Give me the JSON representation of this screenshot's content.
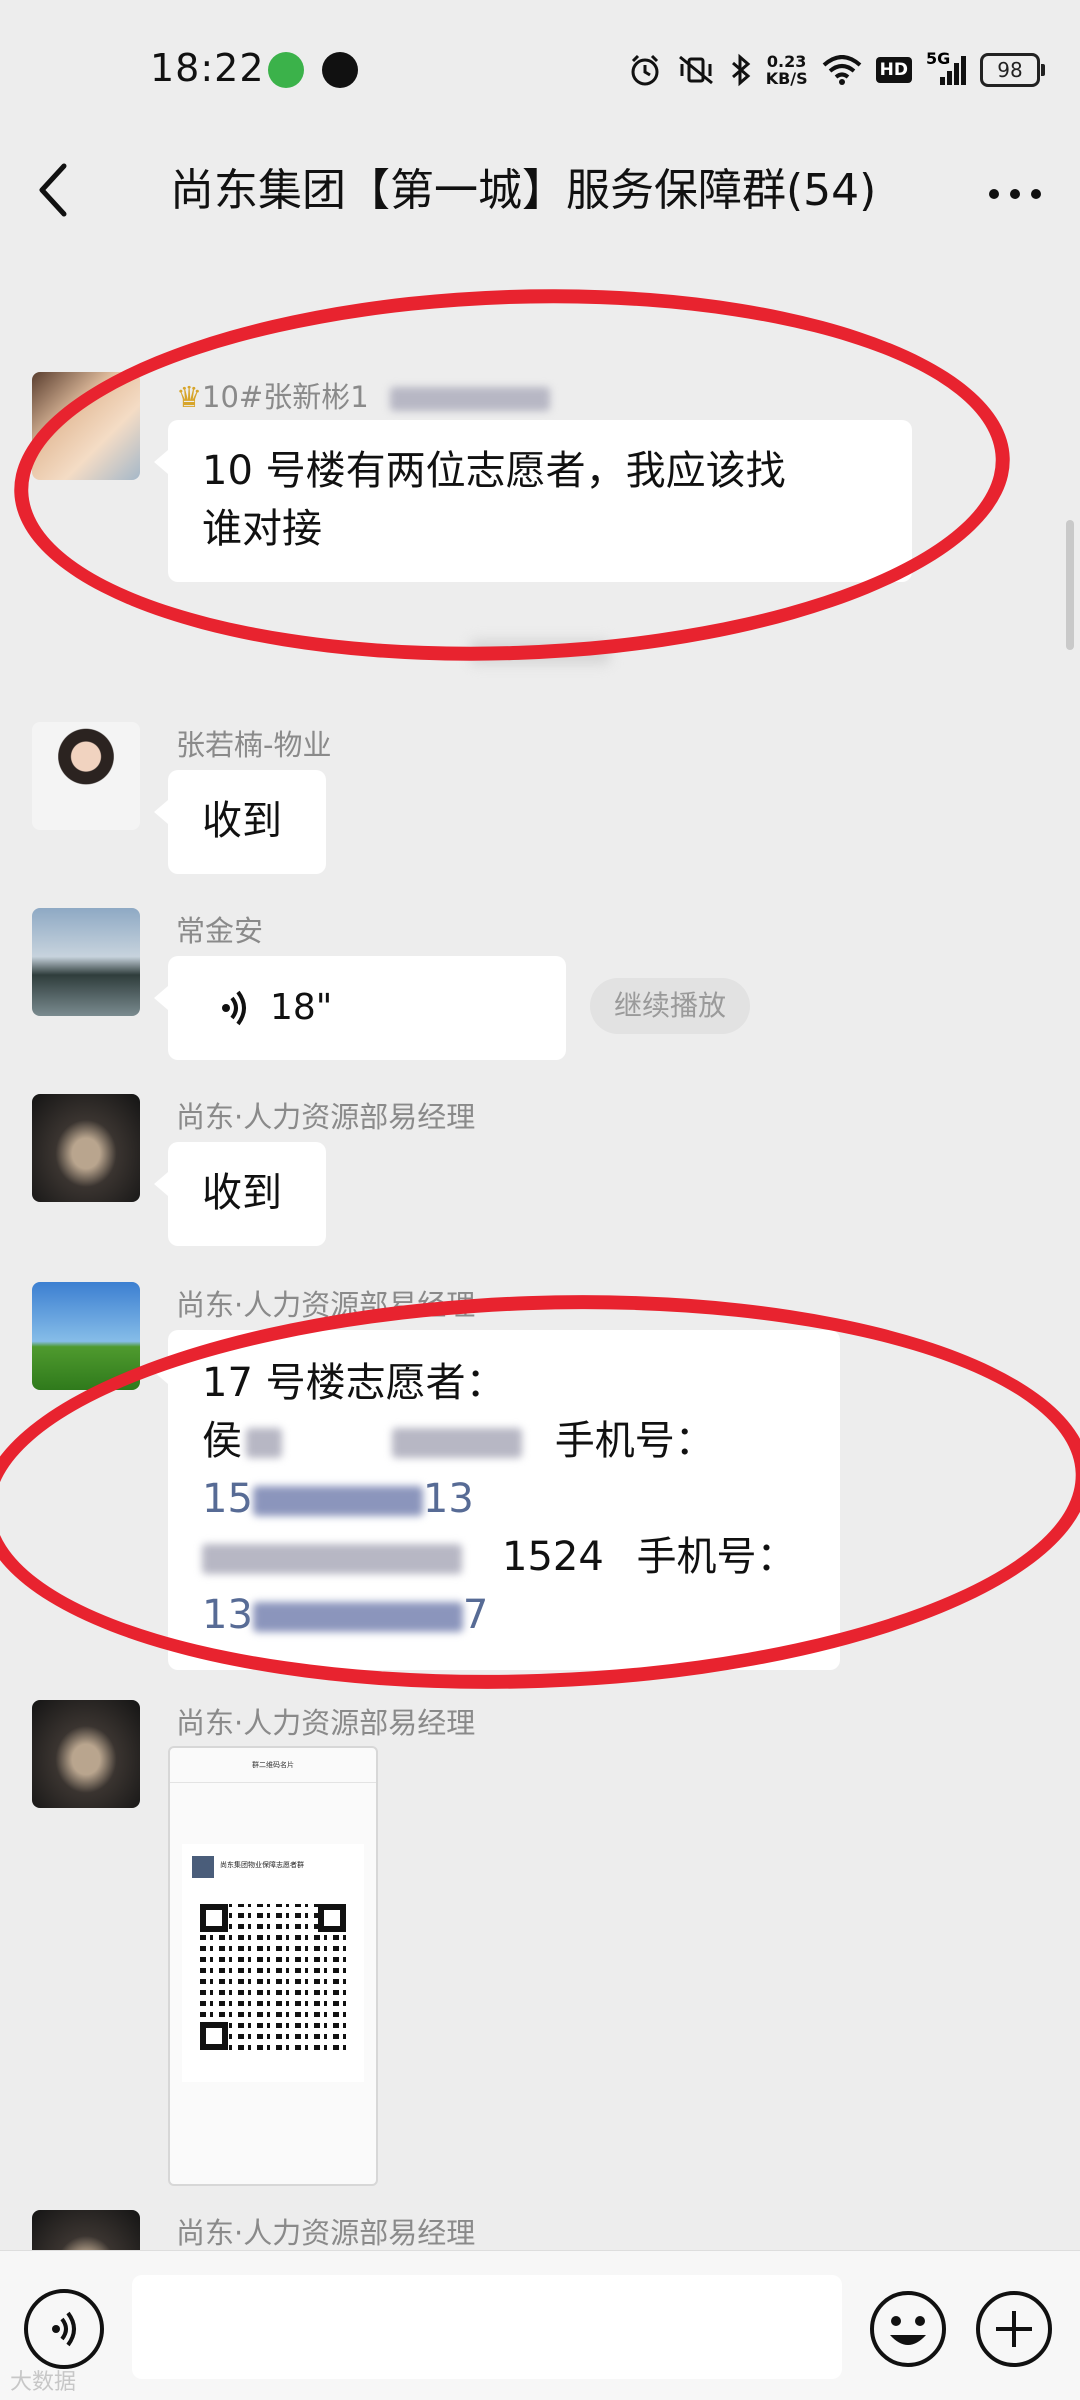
{
  "status_bar": {
    "time": "18:22",
    "net_speed_value": "0.23",
    "net_speed_unit": "KB/S",
    "hd_label": "HD",
    "network_label": "5G",
    "battery": "98"
  },
  "header": {
    "title": "尚东集团【第一城】服务保障群(54)"
  },
  "messages": [
    {
      "sender": "10#张新彬1",
      "text_line1": "10 号楼有两位志愿者，我应该找",
      "text_line2": "谁对接"
    },
    {
      "sender": "张若楠-物业",
      "text": "收到"
    },
    {
      "sender": "常金安",
      "voice_duration": "18\"",
      "continue_label": "继续播放"
    },
    {
      "sender": "尚东·人力资源部易经理",
      "text": "收到"
    },
    {
      "sender": "尚东·人力资源部易经理",
      "line1": "17 号楼志愿者：",
      "line2_prefix": "侯",
      "line2_suffix": "手机号：",
      "line3_start": "15",
      "line3_end": "13",
      "line4_mid": "1524",
      "line4_suffix": "手机号：",
      "line5_start": "13",
      "line5_end": "7"
    },
    {
      "sender": "尚东·人力资源部易经理",
      "image_title": "群二维码名片",
      "image_group": "尚东集团物业保障志愿者群"
    },
    {
      "sender": "尚东·人力资源部易经理"
    }
  ],
  "input": {
    "placeholder": ""
  },
  "watermark": "大数据"
}
